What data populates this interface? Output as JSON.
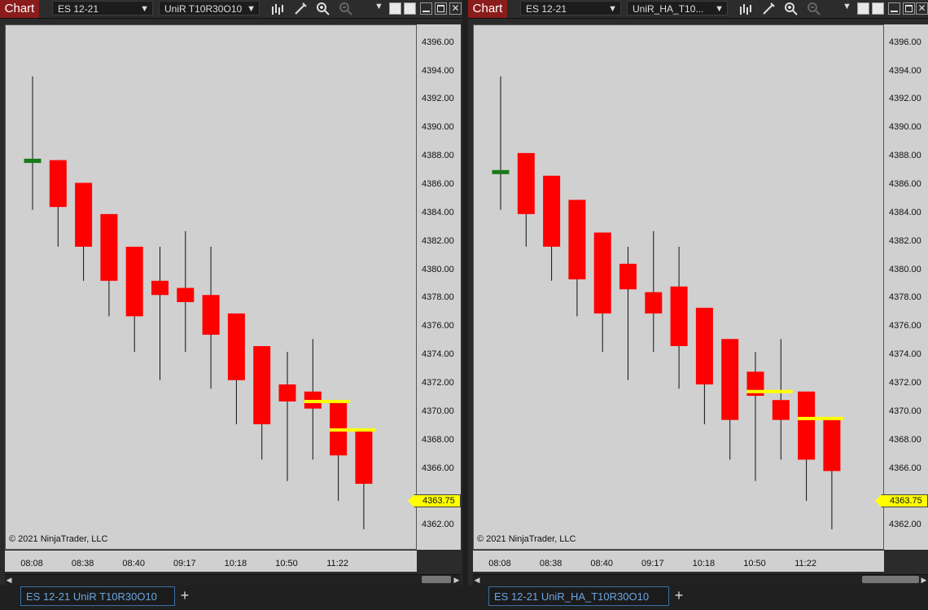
{
  "windows": [
    {
      "chart_label": "Chart",
      "instrument": "ES 12-21",
      "bar_type": "UniR T10R30O10",
      "tab_label": "ES 12-21 UniR T10R30O10",
      "copyright": "© 2021 NinjaTrader, LLC",
      "current_price": "4363.75",
      "y_labels": [
        "4396.00",
        "4394.00",
        "4392.00",
        "4390.00",
        "4388.00",
        "4386.00",
        "4384.00",
        "4382.00",
        "4380.00",
        "4378.00",
        "4376.00",
        "4374.00",
        "4372.00",
        "4370.00",
        "4368.00",
        "4366.00",
        "4362.00"
      ],
      "x_labels": [
        "08:08",
        "08:38",
        "08:40",
        "09:17",
        "10:18",
        "10:50",
        "11:22"
      ]
    },
    {
      "chart_label": "Chart",
      "instrument": "ES 12-21",
      "bar_type": "UniR_HA_T10...",
      "tab_label": "ES 12-21 UniR_HA_T10R30O10",
      "copyright": "© 2021 NinjaTrader, LLC",
      "current_price": "4363.75",
      "y_labels": [
        "4396.00",
        "4394.00",
        "4392.00",
        "4390.00",
        "4388.00",
        "4386.00",
        "4384.00",
        "4382.00",
        "4380.00",
        "4378.00",
        "4376.00",
        "4374.00",
        "4372.00",
        "4370.00",
        "4368.00",
        "4366.00",
        "4362.00"
      ],
      "x_labels": [
        "08:08",
        "08:38",
        "08:40",
        "09:17",
        "10:18",
        "10:50",
        "11:22"
      ]
    }
  ],
  "chart_data": [
    {
      "type": "candlestick",
      "up_color": "#1a7a1a",
      "down_color": "#ff0000",
      "level_color": "#ffff00",
      "ylim": [
        4360.3,
        4397.3
      ],
      "candles": [
        {
          "o": 4387.9,
          "c": 4387.6,
          "h": 4393.7,
          "l": 4384.3
        },
        {
          "o": 4387.8,
          "c": 4384.5,
          "h": 4387.8,
          "l": 4381.7
        },
        {
          "o": 4386.2,
          "c": 4381.7,
          "h": 4386.2,
          "l": 4379.3
        },
        {
          "o": 4384.0,
          "c": 4379.3,
          "h": 4384.0,
          "l": 4376.8
        },
        {
          "o": 4381.7,
          "c": 4376.8,
          "h": 4381.7,
          "l": 4374.3
        },
        {
          "o": 4379.3,
          "c": 4378.3,
          "h": 4381.7,
          "l": 4372.3
        },
        {
          "o": 4378.8,
          "c": 4377.8,
          "h": 4382.8,
          "l": 4374.3
        },
        {
          "o": 4378.3,
          "c": 4375.5,
          "h": 4381.7,
          "l": 4371.7
        },
        {
          "o": 4377.0,
          "c": 4372.3,
          "h": 4377.0,
          "l": 4369.2
        },
        {
          "o": 4374.7,
          "c": 4369.2,
          "h": 4374.7,
          "l": 4366.7
        },
        {
          "o": 4372.0,
          "c": 4370.8,
          "h": 4374.3,
          "l": 4365.2
        },
        {
          "o": 4371.5,
          "c": 4370.3,
          "h": 4375.2,
          "l": 4366.7
        },
        {
          "o": 4370.8,
          "c": 4367.0,
          "h": 4370.8,
          "l": 4363.8
        },
        {
          "o": 4368.8,
          "c": 4365.0,
          "h": 4368.8,
          "l": 4361.8
        }
      ],
      "levels": [
        {
          "price": 4370.8,
          "from": 11,
          "to": 12
        },
        {
          "price": 4368.8,
          "from": 12,
          "to": 13
        }
      ]
    },
    {
      "type": "candlestick",
      "up_color": "#1a7a1a",
      "down_color": "#ff0000",
      "level_color": "#ffff00",
      "ylim": [
        4360.3,
        4397.3
      ],
      "candles": [
        {
          "o": 4387.1,
          "c": 4387.1,
          "h": 4393.7,
          "l": 4384.3
        },
        {
          "o": 4388.3,
          "c": 4384.0,
          "h": 4388.3,
          "l": 4381.7
        },
        {
          "o": 4386.7,
          "c": 4381.7,
          "h": 4386.7,
          "l": 4379.3
        },
        {
          "o": 4385.0,
          "c": 4379.4,
          "h": 4385.0,
          "l": 4376.8
        },
        {
          "o": 4382.7,
          "c": 4377.0,
          "h": 4382.7,
          "l": 4374.3
        },
        {
          "o": 4380.5,
          "c": 4378.7,
          "h": 4381.7,
          "l": 4372.3
        },
        {
          "o": 4378.5,
          "c": 4377.0,
          "h": 4382.8,
          "l": 4374.3
        },
        {
          "o": 4378.9,
          "c": 4374.7,
          "h": 4381.7,
          "l": 4371.7
        },
        {
          "o": 4377.4,
          "c": 4372.0,
          "h": 4377.4,
          "l": 4369.2
        },
        {
          "o": 4375.2,
          "c": 4369.5,
          "h": 4375.2,
          "l": 4366.7
        },
        {
          "o": 4372.9,
          "c": 4371.2,
          "h": 4374.3,
          "l": 4365.2
        },
        {
          "o": 4370.9,
          "c": 4369.5,
          "h": 4375.2,
          "l": 4366.7
        },
        {
          "o": 4371.5,
          "c": 4366.7,
          "h": 4371.5,
          "l": 4363.8
        },
        {
          "o": 4369.6,
          "c": 4365.9,
          "h": 4369.6,
          "l": 4361.8
        }
      ],
      "levels": [
        {
          "price": 4371.5,
          "from": 10,
          "to": 11
        },
        {
          "price": 4369.6,
          "from": 12,
          "to": 13
        }
      ]
    }
  ]
}
